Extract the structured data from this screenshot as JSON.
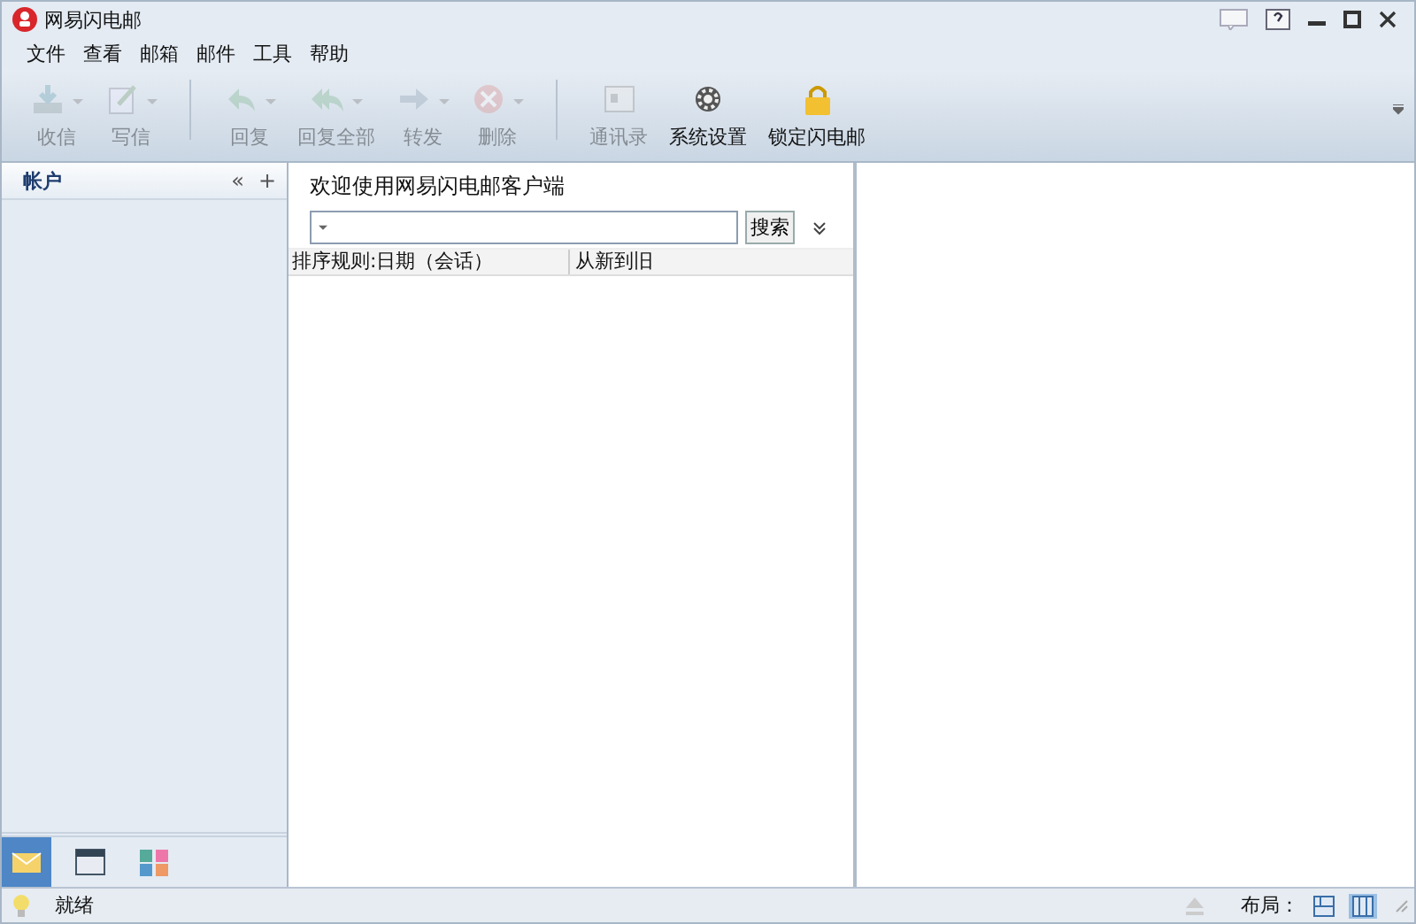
{
  "window": {
    "title": "网易闪电邮"
  },
  "menu": [
    "文件",
    "查看",
    "邮箱",
    "邮件",
    "工具",
    "帮助"
  ],
  "toolbar": [
    {
      "kind": "button",
      "label": "收信",
      "disabled": true,
      "dropdown": true
    },
    {
      "kind": "button",
      "label": "写信",
      "disabled": true,
      "dropdown": true
    },
    {
      "kind": "separator"
    },
    {
      "kind": "button",
      "label": "回复",
      "disabled": true,
      "dropdown": true
    },
    {
      "kind": "button",
      "label": "回复全部",
      "disabled": true,
      "dropdown": true
    },
    {
      "kind": "button",
      "label": "转发",
      "disabled": true,
      "dropdown": true
    },
    {
      "kind": "button",
      "label": "删除",
      "disabled": true,
      "dropdown": true
    },
    {
      "kind": "separator"
    },
    {
      "kind": "button",
      "label": "通讯录",
      "disabled": true,
      "dropdown": false
    },
    {
      "kind": "button",
      "label": "系统设置",
      "disabled": false,
      "dropdown": false
    },
    {
      "kind": "button",
      "label": "锁定闪电邮",
      "disabled": false,
      "dropdown": false
    }
  ],
  "accounts": {
    "title": "帐户",
    "collapse": "«",
    "add": "+"
  },
  "nav_tabs": [
    {
      "selected": true
    },
    {
      "selected": false
    },
    {
      "selected": false
    }
  ],
  "welcome": "欢迎使用网易闪电邮客户端",
  "search": {
    "button": "搜索"
  },
  "list_header": [
    "排序规则:日期（会话）",
    "从新到旧"
  ],
  "status_bar": {
    "text": "就绪",
    "layout_label": "布局：",
    "layouts": [
      {
        "selected": false
      },
      {
        "selected": true
      }
    ]
  }
}
